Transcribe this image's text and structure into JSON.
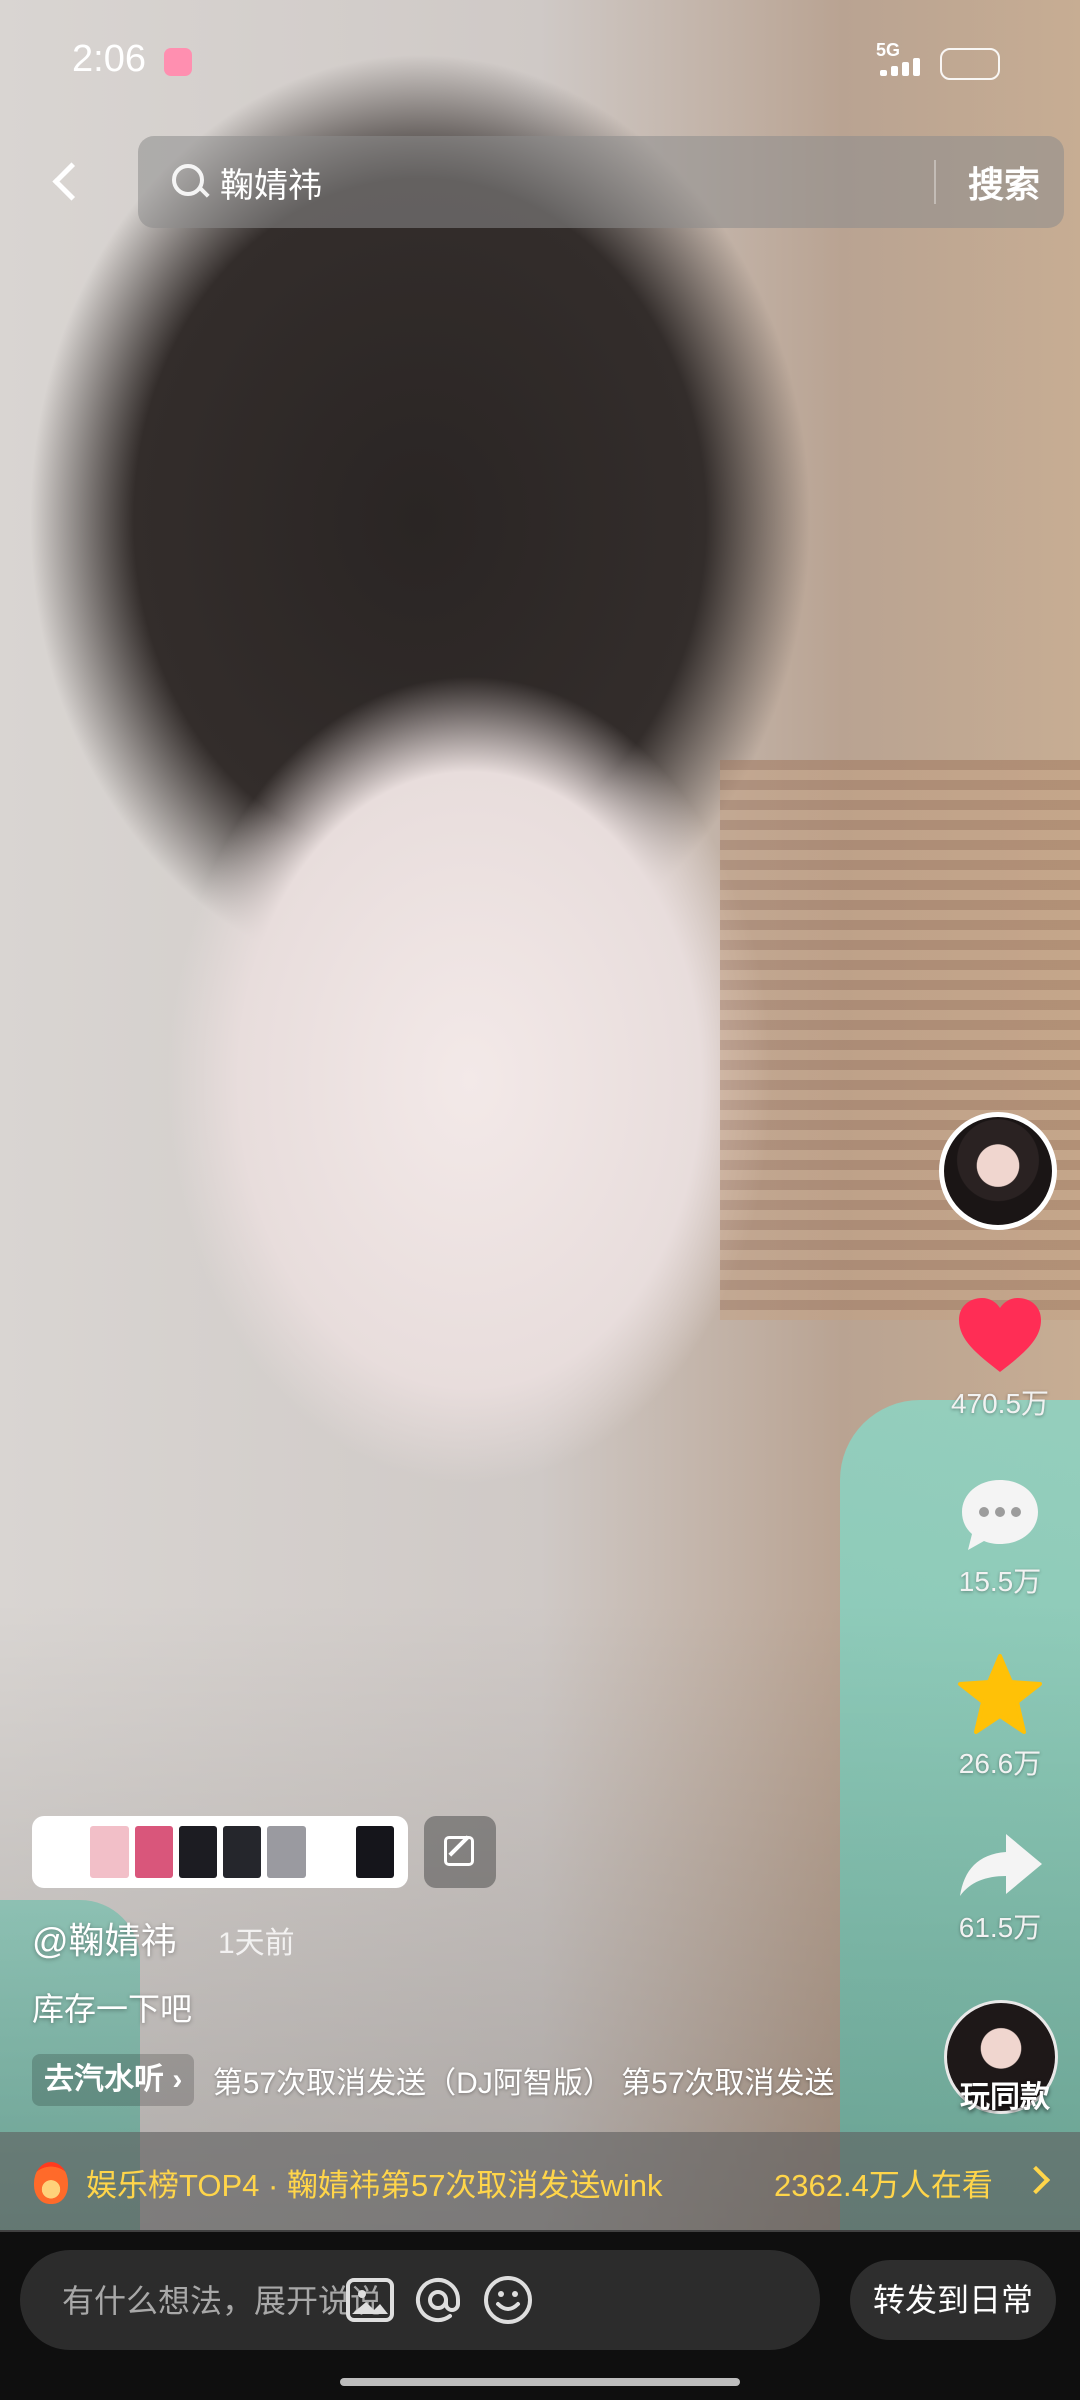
{
  "status_bar": {
    "time": "2:06",
    "network": "5G"
  },
  "header": {
    "search_query": "鞠婧祎",
    "search_button": "搜索"
  },
  "right_rail": {
    "likes": "470.5万",
    "comments": "15.5万",
    "favorites": "26.6万",
    "shares": "61.5万",
    "play_same": "玩同款"
  },
  "post": {
    "author": "@鞠婧祎",
    "time_ago": "1天前",
    "caption": "库存一下吧",
    "music_chip": "去汽水听",
    "music_text": "第57次取消发送（DJ阿智版）  第57次取消发送",
    "palette_colors": [
      "#ffffff",
      "#f2bfc8",
      "#d9567b",
      "#1c1c22",
      "#25262c",
      "#9a9aa0",
      "#ffffff",
      "#15151b"
    ]
  },
  "hot_bar": {
    "text": "娱乐榜TOP4 · 鞠婧祎第57次取消发送wink",
    "viewers": "2362.4万人在看"
  },
  "comment_bar": {
    "placeholder": "有什么想法，展开说说",
    "forward_button": "转发到日常"
  },
  "colors": {
    "heart": "#ff2d55",
    "star": "#ffc107",
    "hot_text": "#ffd54a"
  }
}
